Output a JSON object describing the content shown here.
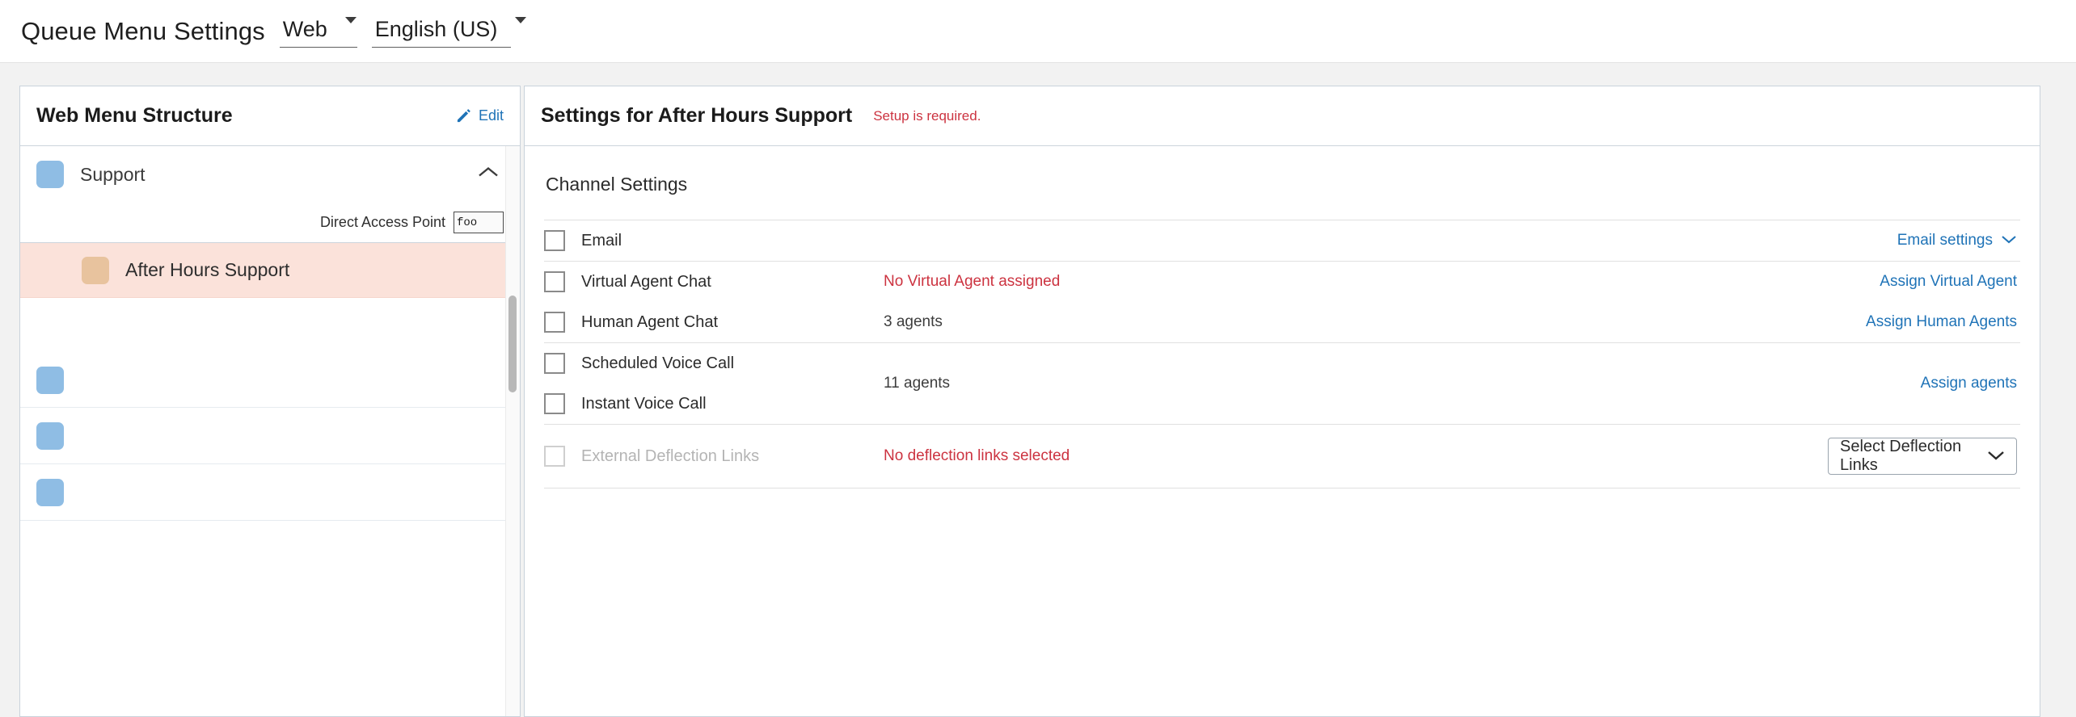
{
  "header": {
    "title": "Queue Menu Settings",
    "channel_select": {
      "value": "Web",
      "icon": "chevron-down-icon"
    },
    "language_select": {
      "value": "English (US)",
      "icon": "chevron-down-icon"
    }
  },
  "left_panel": {
    "title": "Web Menu Structure",
    "edit_label": "Edit",
    "edit_icon": "pencil-icon",
    "collapse_icon": "chevron-up-icon",
    "direct_access_point": {
      "label": "Direct Access Point",
      "value": "foo",
      "placeholder": ""
    },
    "nodes": [
      {
        "label": "Support",
        "swatch": "blue",
        "selected": false,
        "indent": false
      },
      {
        "label": "After Hours Support",
        "swatch": "peach",
        "selected": true,
        "indent": true
      },
      {
        "label": "",
        "swatch": "blue",
        "selected": false,
        "indent": false
      },
      {
        "label": "",
        "swatch": "blue",
        "selected": false,
        "indent": false
      },
      {
        "label": "",
        "swatch": "blue",
        "selected": false,
        "indent": false
      }
    ]
  },
  "right_panel": {
    "title": "Settings for After Hours Support",
    "status": "Setup is required.",
    "section_title": "Channel Settings",
    "groups": [
      {
        "rows": [
          {
            "label": "Email",
            "checked": false,
            "disabled": false,
            "mid": "",
            "mid_kind": "",
            "action": "Email settings",
            "action_icon": "chevron-down-icon"
          }
        ]
      },
      {
        "rows": [
          {
            "label": "Virtual Agent Chat",
            "checked": false,
            "disabled": false,
            "mid": "No Virtual Agent assigned",
            "mid_kind": "warn",
            "action": "Assign Virtual Agent",
            "action_icon": ""
          },
          {
            "label": "Human Agent Chat",
            "checked": false,
            "disabled": false,
            "mid": "3 agents",
            "mid_kind": "plain",
            "action": "Assign Human Agents",
            "action_icon": ""
          }
        ]
      },
      {
        "group_mid": "11 agents",
        "group_action": "Assign agents",
        "rows": [
          {
            "label": "Scheduled Voice Call",
            "checked": false,
            "disabled": false
          },
          {
            "label": "Instant Voice Call",
            "checked": false,
            "disabled": false
          }
        ]
      },
      {
        "rows": [
          {
            "label": "External Deflection Links",
            "checked": false,
            "disabled": true,
            "mid": "No deflection links selected",
            "mid_kind": "warn",
            "dropdown": {
              "value": "Select Deflection Links",
              "icon": "chevron-down-icon"
            }
          }
        ]
      }
    ]
  },
  "colors": {
    "accent_link": "#1f73b7",
    "danger": "#cc3340",
    "swatch_blue": "#8fbde4",
    "swatch_peach": "#e8c39e",
    "row_selected_bg": "#fbe2da",
    "workspace_bg": "#f2f2f2"
  }
}
